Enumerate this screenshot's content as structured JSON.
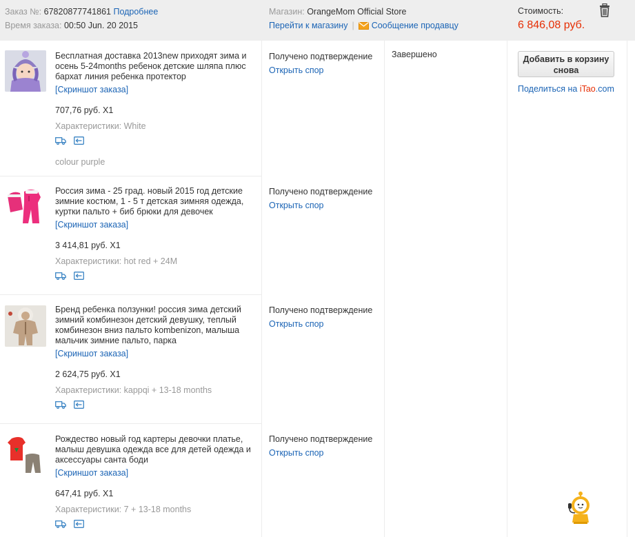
{
  "header": {
    "order_label": "Заказ №:",
    "order_number": "67820877741861",
    "details_link": "Подробнее",
    "time_label": "Время заказа:",
    "time_value": "00:50 Jun. 20 2015",
    "store_label": "Магазин:",
    "store_name": "OrangeMom Official Store",
    "go_store_link": "Перейти к магазину",
    "message_seller_link": "Сообщение продавцу",
    "cost_label": "Стоимость:",
    "cost_value": "6 846,08 руб."
  },
  "items": [
    {
      "title": "Бесплатная доставка 2013new приходят зима и осень 5-24months ребенок детские шляпа плюс бархат линия ребенка протектор",
      "snapshot": "[Скриншот заказа]",
      "price": "707,76 руб. X1",
      "props": "Характеристики: White",
      "extra": "colour purple",
      "status": "Получено подтверждение",
      "dispute": "Открыть спор"
    },
    {
      "title": "Россия зима - 25 град. новый 2015 год детские зимние костюм, 1 - 5 т детская зимняя одежда, куртки пальто + биб брюки для девочек",
      "snapshot": "[Скриншот заказа]",
      "price": "3 414,81 руб. X1",
      "props": "Характеристики: hot red + 24M",
      "status": "Получено подтверждение",
      "dispute": "Открыть спор"
    },
    {
      "title": "Бренд ребенка ползунки! россия зима детский зимний комбинезон детский девушку, теплый комбинезон вниз пальто kombenizon, малыша мальчик зимние пальто, парка",
      "snapshot": "[Скриншот заказа]",
      "price": "2 624,75 руб. X1",
      "props": "Характеристики: kappqi + 13-18 months",
      "status": "Получено подтверждение",
      "dispute": "Открыть спор"
    },
    {
      "title": "Рождество новый год картеры девочки платье, малыш девушка одежда все для детей одежда и аксессуары санта боди",
      "snapshot": "[Скриншот заказа]",
      "price": "647,41 руб. X1",
      "props": "Характеристики: 7 + 13-18 months",
      "status": "Получено подтверждение",
      "dispute": "Открыть спор"
    }
  ],
  "order_status": "Завершено",
  "actions": {
    "readd_button": "Добавить в корзину снова",
    "share_prefix": "Поделиться на ",
    "share_brand_1": "iTao",
    "share_brand_2": ".com"
  },
  "icons": {
    "trash": "trash-icon",
    "envelope": "envelope-icon",
    "shipping": "shipping-truck-icon",
    "return": "return-icon",
    "assistant": "robot-assistant-icon"
  },
  "colors": {
    "link": "#1b64b5",
    "price_total": "#e62e04",
    "header_bg": "#eeeeee",
    "muted": "#999999",
    "envelope": "#f4a21d",
    "share_brand": "#e62e04"
  }
}
